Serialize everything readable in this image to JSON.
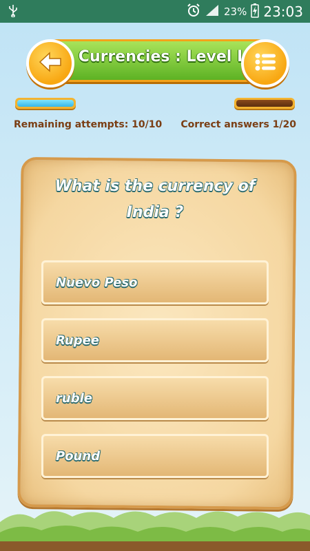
{
  "status_bar": {
    "battery_percent": "23%",
    "time": "23:03",
    "icons": [
      "usb-icon",
      "alarm-icon",
      "signal-icon",
      "battery-charging-icon"
    ]
  },
  "header": {
    "title": "Currencies : Level I",
    "back_icon": "arrow-left-icon",
    "menu_icon": "list-menu-icon",
    "colors": {
      "bar": "#6cc02c",
      "button": "#f8a712",
      "border": "#f4a31a"
    }
  },
  "progress": {
    "remaining_fraction": 1.0,
    "correct_fraction": 0.0
  },
  "stats": {
    "remaining_attempts": "Remaining attempts: 10/10",
    "correct_answers": "Correct answers 1/20"
  },
  "question": {
    "text": "What is the currency of India ?"
  },
  "answers": [
    {
      "label": "Nuevo Peso"
    },
    {
      "label": "Rupee"
    },
    {
      "label": "ruble"
    },
    {
      "label": "Pound"
    }
  ]
}
